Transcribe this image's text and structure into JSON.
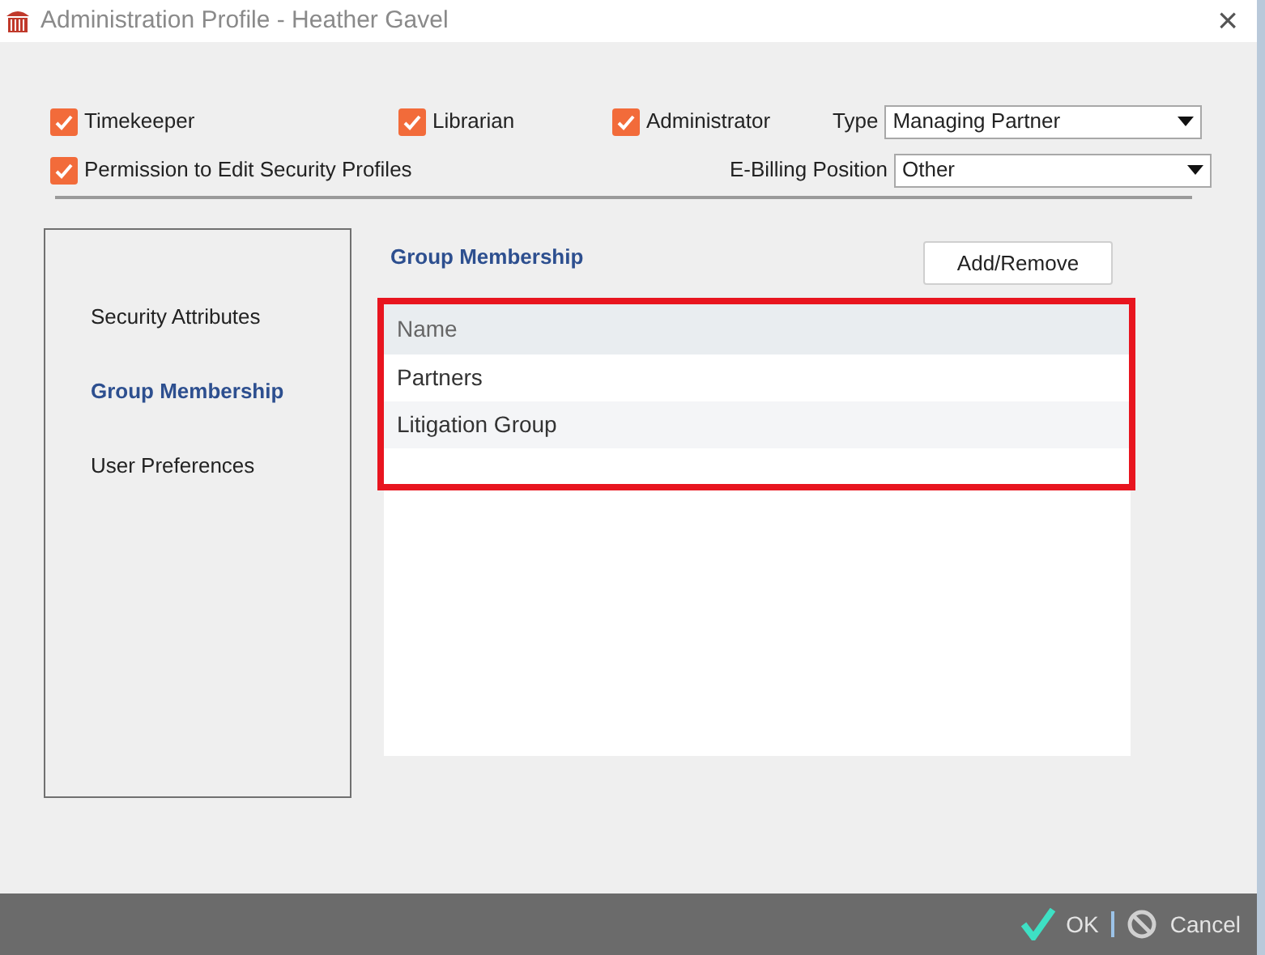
{
  "window": {
    "title": "Administration Profile - Heather Gavel",
    "close": "×"
  },
  "roles": [
    {
      "label": "Timekeeper",
      "checked": true
    },
    {
      "label": "Librarian",
      "checked": true
    },
    {
      "label": "Administrator",
      "checked": true
    }
  ],
  "permission": {
    "label": "Permission to Edit Security Profiles",
    "checked": true
  },
  "type": {
    "label": "Type",
    "value": "Managing Partner"
  },
  "ebilling": {
    "label": "E-Billing Position",
    "value": "Other"
  },
  "sidebar": {
    "items": [
      {
        "label": "Security Attributes",
        "selected": false
      },
      {
        "label": "Group Membership",
        "selected": true
      },
      {
        "label": "User Preferences",
        "selected": false
      }
    ]
  },
  "section_title": "Group Membership",
  "add_button": "Add/Remove",
  "table": {
    "columns": [
      "Name"
    ],
    "rows": [
      "Partners",
      "Litigation Group"
    ]
  },
  "highlight": true,
  "footer": {
    "ok": "OK",
    "cancel": "Cancel"
  }
}
